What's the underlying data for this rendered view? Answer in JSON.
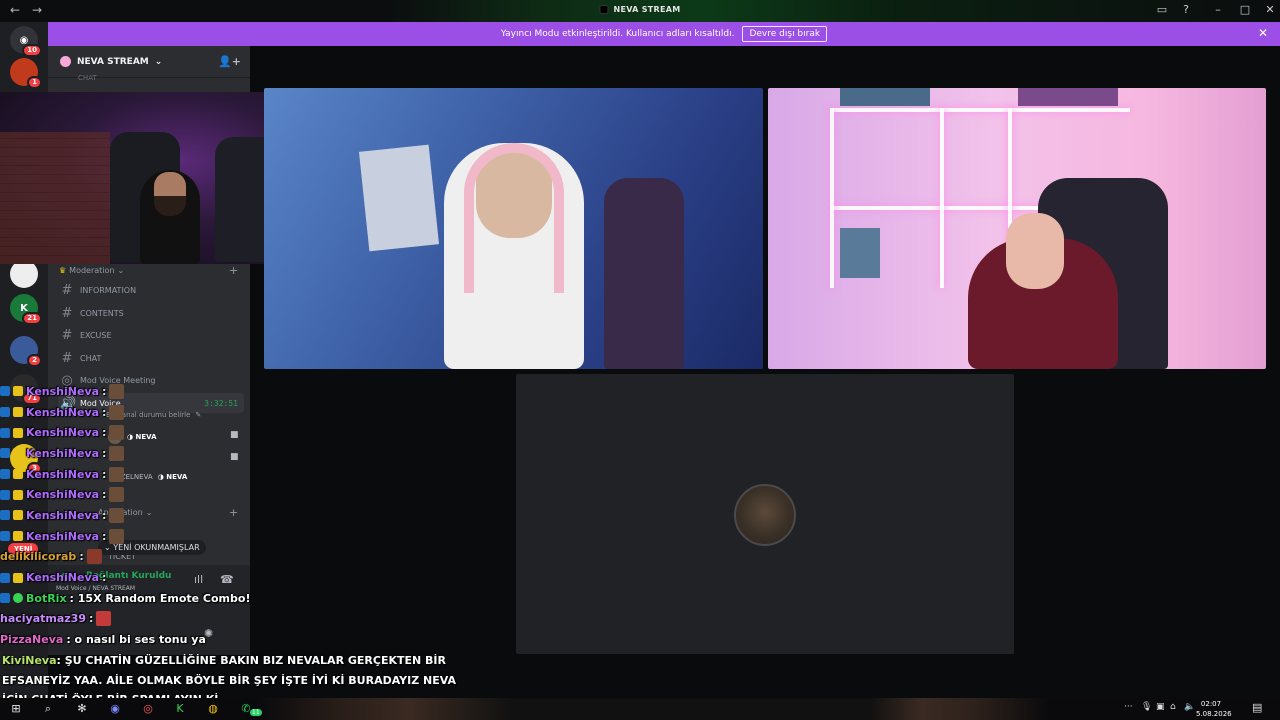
{
  "window": {
    "title": "NEVA STREAM"
  },
  "banner": {
    "text": "Yayıncı Modu etkinleştirildi. Kullanıcı adları kısaltıldı.",
    "button": "Devre dışı bırak"
  },
  "rail": {
    "badges": [
      "10",
      "1",
      "21",
      "2",
      "71",
      "3"
    ]
  },
  "sidebar": {
    "server_name": "NEVA STREAM",
    "cut_channel": "CHAT",
    "category_moderation": "Moderation",
    "channels": [
      "INFORMATION",
      "CONTENTS",
      "EXCUSE",
      "CHAT"
    ],
    "voice_meeting": "Mod Voice Meeting",
    "voice_active": "Mod Voice",
    "voice_timer": "3:32:51",
    "voice_status_hint": "Bir kanal durumu belirle",
    "member_tag_1": "NEVA",
    "member_name_2": "AZELNEVA",
    "member_tag_2": "NEVA",
    "category_application": "Application",
    "ticket": "TICKET",
    "new_pill": "YENİ",
    "unread_label": "YENİ OKUNMAMIŞLAR"
  },
  "voice_panel": {
    "status": "Bağlantı Kuruldu",
    "location": "Mod Voice / NEVA STREAM"
  },
  "chat": {
    "messages": [
      {
        "user": "KenshiNeva",
        "text": ":",
        "color": "#b06bff"
      },
      {
        "user": "KenshiNeva",
        "text": ":",
        "color": "#b06bff"
      },
      {
        "user": "KenshiNeva",
        "text": ":",
        "color": "#b06bff"
      },
      {
        "user": "KenshiNeva",
        "text": ":",
        "color": "#b06bff"
      },
      {
        "user": "KenshiNeva",
        "text": ":",
        "color": "#b06bff"
      },
      {
        "user": "KenshiNeva",
        "text": ":",
        "color": "#b06bff"
      },
      {
        "user": "KenshiNeva",
        "text": ":",
        "color": "#b06bff"
      },
      {
        "user": "KenshiNeva",
        "text": ":",
        "color": "#b06bff"
      },
      {
        "user": "delikilicorab",
        "text": ":",
        "color": "#d7a23a"
      },
      {
        "user": "KenshiNeva",
        "text": ":",
        "color": "#b06bff"
      },
      {
        "user": "BotRix",
        "text": ": 15X Random Emote Combo!",
        "color": "#39d353"
      },
      {
        "user": "haciyatmaz39",
        "text": ":",
        "color": "#c98cff"
      },
      {
        "user": "PizzaNeva",
        "text": ": o nasıl bi ses tonu ya",
        "color": "#e068c9"
      }
    ],
    "long_user": "KiviNeva",
    "long_text": ": ŞU CHATİN GÜZELLİĞİNE BAKIN BIZ NEVALAR GERÇEKTEN BİR EFSANEYİZ YAA. AİLE OLMAK BÖYLE BİR ŞEY İŞTE İYİ Kİ BURADAYIZ NEVA İÇİN CHATİ ÖYLE BİR SPAMLAYIN Kİ."
  },
  "taskbar": {
    "time": "02:07",
    "date": "5.08.2026",
    "whatsapp_badge": "11"
  },
  "colors": {
    "banner": "#9b4fe6",
    "connected": "#23a55a",
    "badge": "#f23f42"
  }
}
